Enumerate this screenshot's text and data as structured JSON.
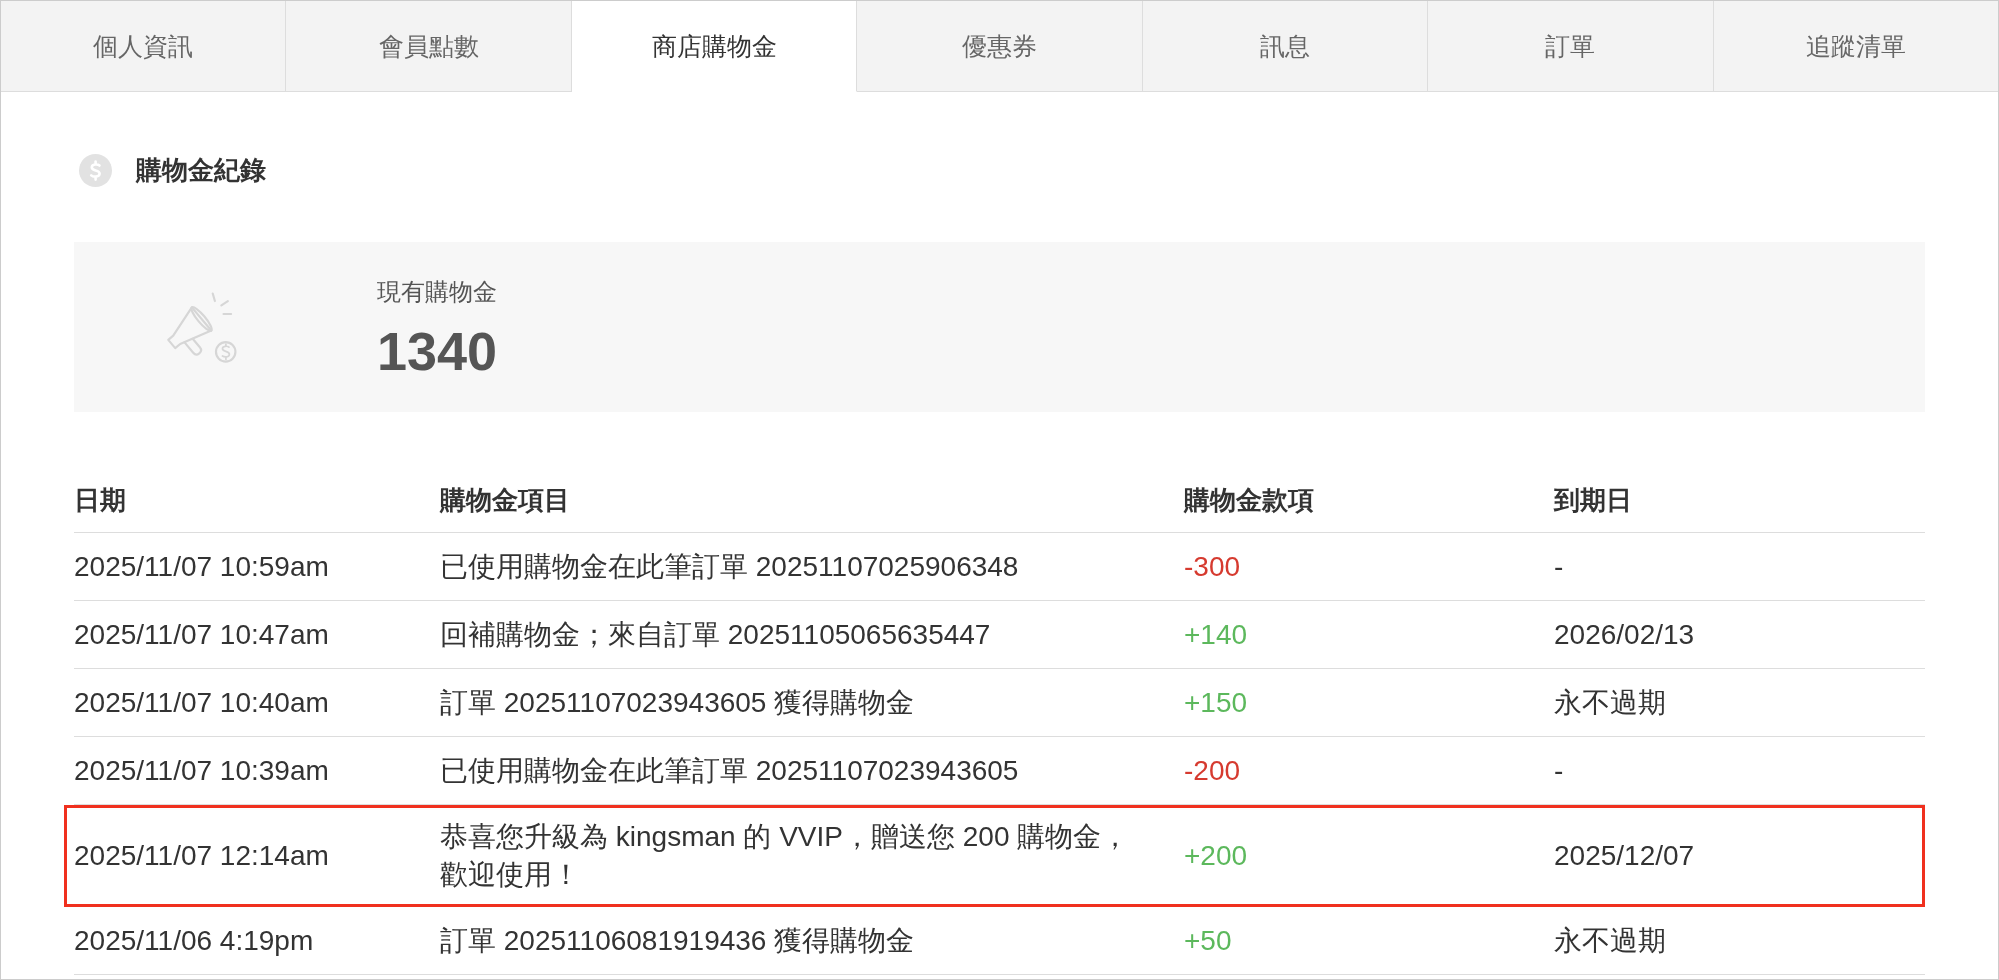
{
  "tabs": [
    {
      "label": "個人資訊",
      "selected": false
    },
    {
      "label": "會員點數",
      "selected": false
    },
    {
      "label": "商店購物金",
      "selected": true
    },
    {
      "label": "優惠券",
      "selected": false
    },
    {
      "label": "訊息",
      "selected": false
    },
    {
      "label": "訂單",
      "selected": false
    },
    {
      "label": "追蹤清單",
      "selected": false
    }
  ],
  "section": {
    "title": "購物金紀錄"
  },
  "balance": {
    "label": "現有購物金",
    "value": "1340"
  },
  "table": {
    "columns": [
      "日期",
      "購物金項目",
      "購物金款項",
      "到期日"
    ],
    "rows": [
      {
        "date": "2025/11/07 10:59am",
        "item": "已使用購物金在此筆訂單 20251107025906348",
        "amount": {
          "value": "-300",
          "color": "#d63a2f"
        },
        "expiry": "-",
        "highlighted": false
      },
      {
        "date": "2025/11/07 10:47am",
        "item": "回補購物金；來自訂單 20251105065635447",
        "amount": {
          "value": "+140",
          "color": "#5cb85c"
        },
        "expiry": "2026/02/13",
        "highlighted": false
      },
      {
        "date": "2025/11/07 10:40am",
        "item": "訂單 20251107023943605 獲得購物金",
        "amount": {
          "value": "+150",
          "color": "#5cb85c"
        },
        "expiry": "永不過期",
        "highlighted": false
      },
      {
        "date": "2025/11/07 10:39am",
        "item": "已使用購物金在此筆訂單 20251107023943605",
        "amount": {
          "value": "-200",
          "color": "#d63a2f"
        },
        "expiry": "-",
        "highlighted": false
      },
      {
        "date": "2025/11/07 12:14am",
        "item": "恭喜您升級為 kingsman 的 VVIP，贈送您 200 購物金，歡迎使用！",
        "amount": {
          "value": "+200",
          "color": "#5cb85c"
        },
        "expiry": "2025/12/07",
        "highlighted": true
      },
      {
        "date": "2025/11/06 4:19pm",
        "item": "訂單 20251106081919436 獲得購物金",
        "amount": {
          "value": "+50",
          "color": "#5cb85c"
        },
        "expiry": "永不過期",
        "highlighted": false
      }
    ]
  }
}
